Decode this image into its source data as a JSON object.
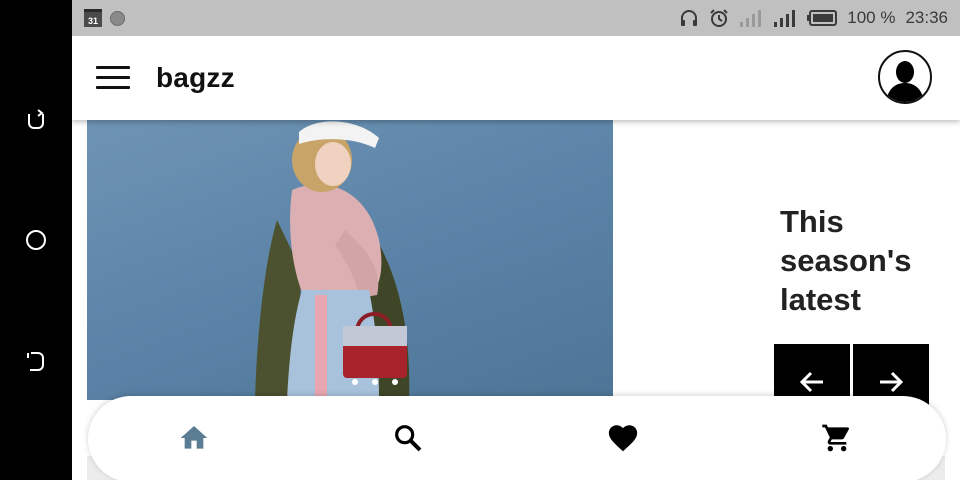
{
  "status_bar": {
    "calendar_day": "31",
    "battery": "100 %",
    "time": "23:36",
    "icons": [
      "calendar-icon",
      "notification-dot-icon",
      "headphones-icon",
      "alarm-icon",
      "signal-icon",
      "signal-icon",
      "battery-icon"
    ]
  },
  "system_nav": {
    "icons": [
      "recents-icon",
      "home-circle-icon",
      "back-icon"
    ]
  },
  "appbar": {
    "title": "bagzz",
    "menu_icon": "hamburger-menu-icon",
    "avatar_icon": "user-avatar-icon"
  },
  "hero": {
    "image": "woman-with-red-handbag-photo"
  },
  "promo": {
    "headline_line1": "This",
    "headline_line2": "season's",
    "headline_line3": "latest",
    "prev_icon": "arrow-left-icon",
    "next_icon": "arrow-right-icon"
  },
  "bottom_nav": {
    "items": [
      {
        "icon": "home-icon",
        "active": true
      },
      {
        "icon": "search-icon",
        "active": false
      },
      {
        "icon": "heart-icon",
        "active": false
      },
      {
        "icon": "cart-icon",
        "active": false
      }
    ]
  },
  "colors": {
    "active_nav": "#5a7d94",
    "status_bar_bg": "#c0c0c0",
    "hero_bg": "#5a82a6"
  }
}
